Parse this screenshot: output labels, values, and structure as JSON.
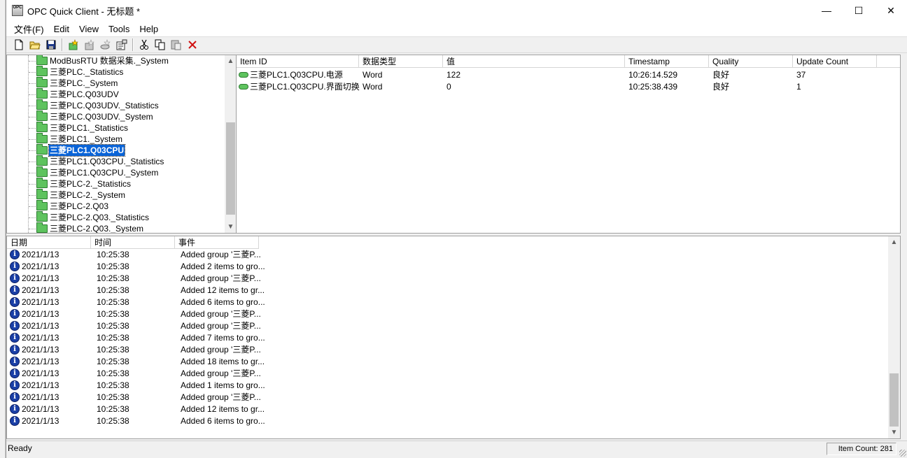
{
  "window": {
    "title": "OPC Quick Client - 无标题 *",
    "app_icon_text": "OPC",
    "minimize": "—",
    "maximize": "☐",
    "close": "✕"
  },
  "menu": [
    "文件(F)",
    "Edit",
    "View",
    "Tools",
    "Help"
  ],
  "toolbar": [
    "new-file",
    "open-folder",
    "save",
    "new-server",
    "new-group",
    "new-item",
    "properties",
    "cut",
    "copy",
    "paste",
    "delete"
  ],
  "tree": {
    "items": [
      "ModBusRTU 数据采集._System",
      "三菱PLC._Statistics",
      "三菱PLC._System",
      "三菱PLC.Q03UDV",
      "三菱PLC.Q03UDV._Statistics",
      "三菱PLC.Q03UDV._System",
      "三菱PLC1._Statistics",
      "三菱PLC1._System",
      "三菱PLC1.Q03CPU",
      "三菱PLC1.Q03CPU._Statistics",
      "三菱PLC1.Q03CPU._System",
      "三菱PLC-2._Statistics",
      "三菱PLC-2._System",
      "三菱PLC-2.Q03",
      "三菱PLC-2.Q03._Statistics",
      "三菱PLC-2.Q03._System"
    ],
    "selected_index": 8
  },
  "items_table": {
    "columns": [
      "Item ID",
      "数据类型",
      "值",
      "Timestamp",
      "Quality",
      "Update Count"
    ],
    "rows": [
      [
        "三菱PLC1.Q03CPU.电源",
        "Word",
        "122",
        "10:26:14.529",
        "良好",
        "37"
      ],
      [
        "三菱PLC1.Q03CPU.界面切换",
        "Word",
        "0",
        "10:25:38.439",
        "良好",
        "1"
      ]
    ]
  },
  "log": {
    "columns": [
      "日期",
      "时间",
      "事件"
    ],
    "rows": [
      [
        "2021/1/13",
        "10:25:38",
        "Added group '三菱P..."
      ],
      [
        "2021/1/13",
        "10:25:38",
        "Added 2 items to gro..."
      ],
      [
        "2021/1/13",
        "10:25:38",
        "Added group '三菱P..."
      ],
      [
        "2021/1/13",
        "10:25:38",
        "Added 12 items to gr..."
      ],
      [
        "2021/1/13",
        "10:25:38",
        "Added 6 items to gro..."
      ],
      [
        "2021/1/13",
        "10:25:38",
        "Added group '三菱P..."
      ],
      [
        "2021/1/13",
        "10:25:38",
        "Added group '三菱P..."
      ],
      [
        "2021/1/13",
        "10:25:38",
        "Added 7 items to gro..."
      ],
      [
        "2021/1/13",
        "10:25:38",
        "Added group '三菱P..."
      ],
      [
        "2021/1/13",
        "10:25:38",
        "Added 18 items to gr..."
      ],
      [
        "2021/1/13",
        "10:25:38",
        "Added group '三菱P..."
      ],
      [
        "2021/1/13",
        "10:25:38",
        "Added 1 items to gro..."
      ],
      [
        "2021/1/13",
        "10:25:38",
        "Added group '三菱P..."
      ],
      [
        "2021/1/13",
        "10:25:38",
        "Added 12 items to gr..."
      ],
      [
        "2021/1/13",
        "10:25:38",
        "Added 6 items to gro..."
      ]
    ]
  },
  "status": {
    "text": "Ready",
    "item_count": "Item Count: 281"
  }
}
